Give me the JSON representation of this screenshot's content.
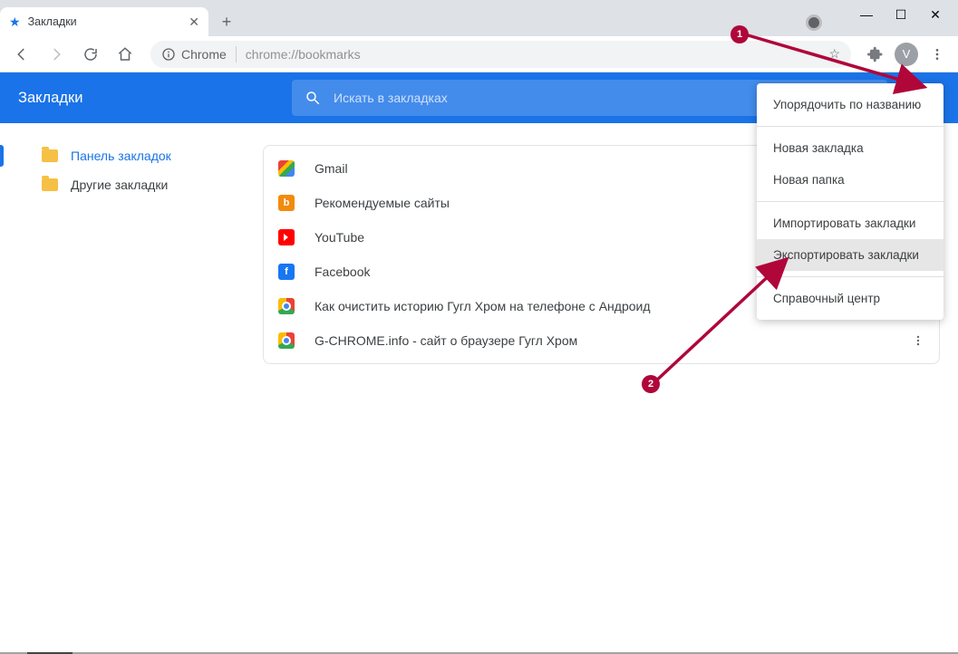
{
  "tab": {
    "title": "Закладки"
  },
  "omnibox": {
    "secure_label": "Chrome",
    "url": "chrome://bookmarks"
  },
  "avatar_letter": "V",
  "header": {
    "title": "Закладки",
    "search_placeholder": "Искать в закладках"
  },
  "sidebar": {
    "items": [
      {
        "label": "Панель закладок",
        "selected": true
      },
      {
        "label": "Другие закладки",
        "selected": false
      }
    ]
  },
  "bookmarks": [
    {
      "icon": "gmail",
      "label": "Gmail"
    },
    {
      "icon": "bing",
      "label": "Рекомендуемые сайты"
    },
    {
      "icon": "youtube",
      "label": "YouTube"
    },
    {
      "icon": "facebook",
      "label": "Facebook"
    },
    {
      "icon": "chrome",
      "label": "Как очистить историю Гугл Хром на телефоне с Андроид"
    },
    {
      "icon": "chrome",
      "label": "G-CHROME.info - сайт о браузере Гугл Хром"
    }
  ],
  "menu": {
    "sort": "Упорядочить по названию",
    "new_bookmark": "Новая закладка",
    "new_folder": "Новая папка",
    "import": "Импортировать закладки",
    "export": "Экспортировать закладки",
    "help": "Справочный центр"
  },
  "annotations": {
    "n1": "1",
    "n2": "2"
  }
}
